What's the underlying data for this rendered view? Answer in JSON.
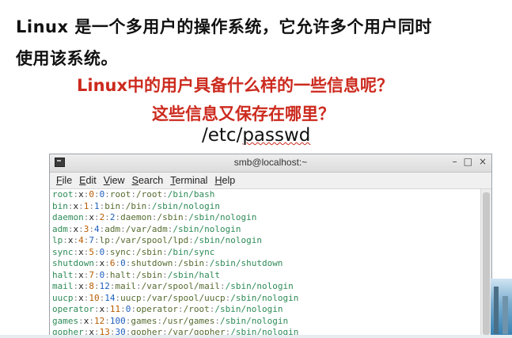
{
  "slide": {
    "line1": "Linux 是一个多用户的操作系统，它允许多个用户同时",
    "line2": "使用该系统。",
    "question1": "Linux中的用户具备什么样的一些信息呢？",
    "question2": "这些信息又保存在哪里？",
    "path_prefix": "/etc/",
    "path_wavy": "passwd"
  },
  "terminal": {
    "title": "smb@localhost:~",
    "window_buttons": [
      "–",
      "□",
      "×"
    ],
    "menu": [
      "File",
      "Edit",
      "View",
      "Search",
      "Terminal",
      "Help"
    ],
    "lines": [
      [
        "root",
        "x",
        "0",
        "0",
        "root",
        "/root",
        "/bin/bash"
      ],
      [
        "bin",
        "x",
        "1",
        "1",
        "bin",
        "/bin",
        "/sbin/nologin"
      ],
      [
        "daemon",
        "x",
        "2",
        "2",
        "daemon",
        "/sbin",
        "/sbin/nologin"
      ],
      [
        "adm",
        "x",
        "3",
        "4",
        "adm",
        "/var/adm",
        "/sbin/nologin"
      ],
      [
        "lp",
        "x",
        "4",
        "7",
        "lp",
        "/var/spool/lpd",
        "/sbin/nologin"
      ],
      [
        "sync",
        "x",
        "5",
        "0",
        "sync",
        "/sbin",
        "/bin/sync"
      ],
      [
        "shutdown",
        "x",
        "6",
        "0",
        "shutdown",
        "/sbin",
        "/sbin/shutdown"
      ],
      [
        "halt",
        "x",
        "7",
        "0",
        "halt",
        "/sbin",
        "/sbin/halt"
      ],
      [
        "mail",
        "x",
        "8",
        "12",
        "mail",
        "/var/spool/mail",
        "/sbin/nologin"
      ],
      [
        "uucp",
        "x",
        "10",
        "14",
        "uucp",
        "/var/spool/uucp",
        "/sbin/nologin"
      ],
      [
        "operator",
        "x",
        "11",
        "0",
        "operator",
        "/root",
        "/sbin/nologin"
      ],
      [
        "games",
        "x",
        "12",
        "100",
        "games",
        "/usr/games",
        "/sbin/nologin"
      ],
      [
        "gopher",
        "x",
        "13",
        "30",
        "gopher",
        "/var/gopher",
        "/sbin/nologin"
      ]
    ],
    "colors": {
      "user": "#2e8b57",
      "passwd": "#222222",
      "uid": "#b85c00",
      "gid": "#1f5fbf",
      "home": "#556b2f"
    }
  }
}
